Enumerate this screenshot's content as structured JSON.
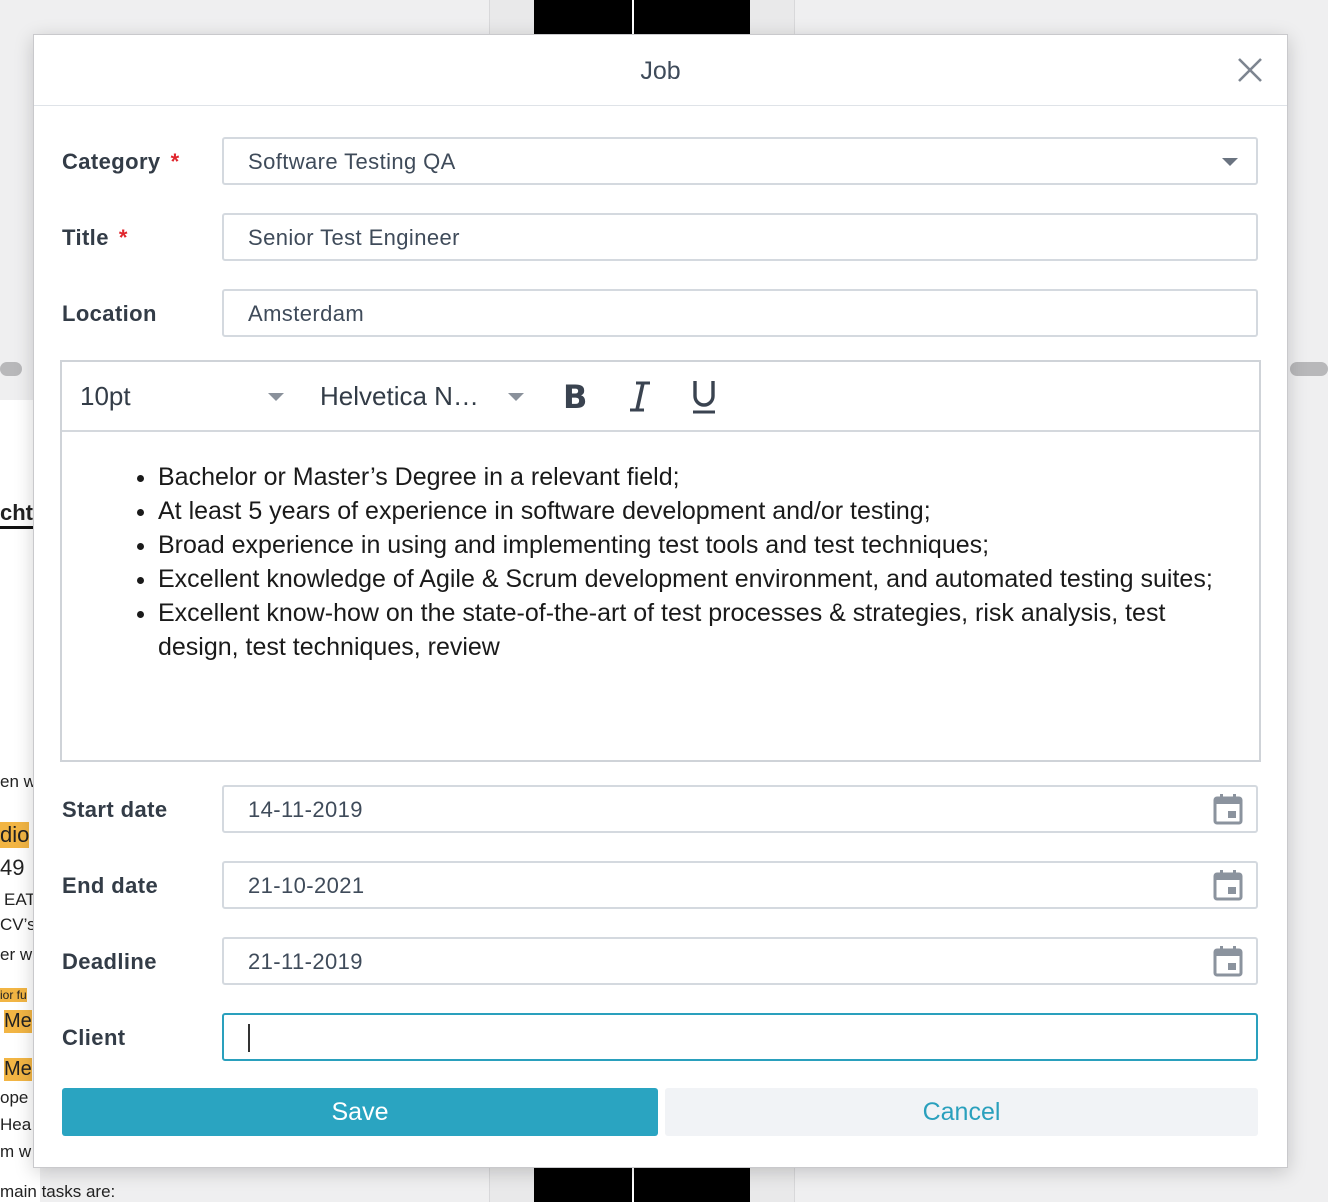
{
  "dialog": {
    "title": "Job",
    "close_icon": "close-icon"
  },
  "form": {
    "category": {
      "label": "Category",
      "required_mark": "*",
      "value": "Software Testing QA"
    },
    "title": {
      "label": "Title",
      "required_mark": "*",
      "value": "Senior Test Engineer"
    },
    "location": {
      "label": "Location",
      "value": "Amsterdam"
    },
    "start_date": {
      "label": "Start date",
      "value": "14-11-2019"
    },
    "end_date": {
      "label": "End date",
      "value": "21-10-2021"
    },
    "deadline": {
      "label": "Deadline",
      "value": "21-11-2019"
    },
    "client": {
      "label": "Client",
      "value": ""
    }
  },
  "editor": {
    "font_size": "10pt",
    "font_family": "Helvetica N…",
    "toolbar_icons": [
      "bold-icon",
      "italic-icon",
      "underline-icon"
    ],
    "bullets": [
      "Bachelor or Master’s Degree in a relevant field;",
      "At least 5 years of experience in software development and/or testing;",
      "Broad experience in using and implementing test tools and test techniques;",
      "Excellent knowledge of Agile & Scrum development environment, and automated testing suites;",
      "Excellent know-how on the state-of-the-art of test processes & strategies, risk analysis, test design, test techniques, review"
    ]
  },
  "buttons": {
    "save": "Save",
    "cancel": "Cancel"
  },
  "background": {
    "fragments": [
      "cht",
      "en w",
      "dio",
      "49",
      "EAT",
      "CV’s",
      "er w",
      "ior fu",
      "Me",
      "Me",
      "ope",
      "Hea",
      "m w"
    ],
    "bottom_text": "main tasks are:"
  },
  "colors": {
    "accent": "#2aa4c1",
    "required": "#e0262d",
    "text": "#3f4b5a"
  }
}
